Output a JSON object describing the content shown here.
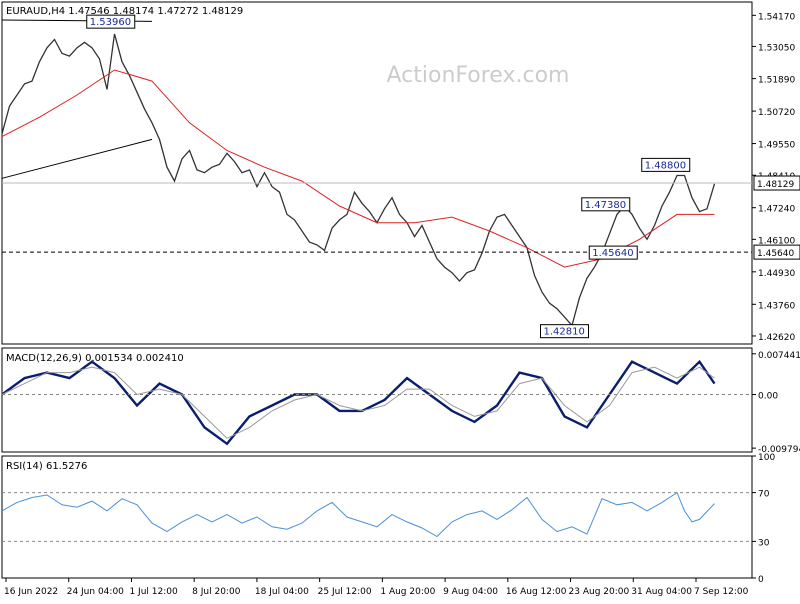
{
  "chart_data": {
    "type": "line",
    "symbol_header": "EURAUD,H4  1.47546 1.48174 1.47272 1.48129",
    "watermark": "ActionForex.com",
    "price_panel": {
      "ylim": [
        1.4233,
        1.5465
      ],
      "y_ticks": [
        "1.54170",
        "1.53050",
        "1.51890",
        "1.50720",
        "1.49550",
        "1.48410",
        "1.47240",
        "1.46100",
        "1.44930",
        "1.43760",
        "1.42620"
      ],
      "current_price": 1.48129,
      "current_price_label": "1.48129",
      "dashed_level": 1.4564,
      "dashed_level_label": "1.45640",
      "annotations": [
        {
          "label": "1.53960",
          "x": 0.145,
          "y": 1.5396
        },
        {
          "label": "1.48800",
          "x": 0.885,
          "y": 1.488
        },
        {
          "label": "1.47380",
          "x": 0.805,
          "y": 1.4738
        },
        {
          "label": "1.45640",
          "x": 0.815,
          "y": 1.4564
        },
        {
          "label": "1.42810",
          "x": 0.75,
          "y": 1.4281
        }
      ],
      "series": [
        {
          "name": "",
          "color": "#333333",
          "kind": "price",
          "x": [
            0,
            0.01,
            0.02,
            0.03,
            0.04,
            0.05,
            0.06,
            0.07,
            0.08,
            0.09,
            0.1,
            0.11,
            0.12,
            0.13,
            0.14,
            0.15,
            0.16,
            0.17,
            0.18,
            0.19,
            0.2,
            0.21,
            0.22,
            0.23,
            0.24,
            0.25,
            0.26,
            0.27,
            0.28,
            0.29,
            0.3,
            0.31,
            0.32,
            0.33,
            0.34,
            0.35,
            0.36,
            0.37,
            0.38,
            0.39,
            0.4,
            0.41,
            0.42,
            0.43,
            0.44,
            0.45,
            0.46,
            0.47,
            0.48,
            0.49,
            0.5,
            0.51,
            0.52,
            0.53,
            0.54,
            0.55,
            0.56,
            0.57,
            0.58,
            0.59,
            0.6,
            0.61,
            0.62,
            0.63,
            0.64,
            0.65,
            0.66,
            0.67,
            0.68,
            0.69,
            0.7,
            0.71,
            0.72,
            0.73,
            0.74,
            0.75,
            0.76,
            0.77,
            0.78,
            0.79,
            0.8,
            0.81,
            0.82,
            0.83,
            0.84,
            0.85,
            0.86,
            0.87,
            0.88,
            0.89,
            0.9,
            0.91,
            0.92,
            0.93,
            0.94,
            0.95
          ],
          "y": [
            1.499,
            1.509,
            1.513,
            1.517,
            1.518,
            1.525,
            1.53,
            1.533,
            1.528,
            1.527,
            1.53,
            1.532,
            1.53,
            1.526,
            1.515,
            1.535,
            1.525,
            1.52,
            1.514,
            1.508,
            1.503,
            1.497,
            1.487,
            1.482,
            1.49,
            1.493,
            1.486,
            1.485,
            1.487,
            1.488,
            1.492,
            1.489,
            1.485,
            1.486,
            1.48,
            1.485,
            1.48,
            1.478,
            1.47,
            1.468,
            1.464,
            1.46,
            1.459,
            1.457,
            1.465,
            1.468,
            1.47,
            1.478,
            1.474,
            1.471,
            1.467,
            1.472,
            1.476,
            1.47,
            1.467,
            1.462,
            1.466,
            1.46,
            1.454,
            1.451,
            1.449,
            1.446,
            1.449,
            1.45,
            1.456,
            1.464,
            1.469,
            1.47,
            1.466,
            1.462,
            1.458,
            1.448,
            1.442,
            1.438,
            1.436,
            1.433,
            1.43,
            1.44,
            1.447,
            1.451,
            1.456,
            1.463,
            1.47,
            1.473,
            1.47,
            1.465,
            1.461,
            1.466,
            1.473,
            1.478,
            1.484,
            1.484,
            1.476,
            1.471,
            1.472,
            1.481
          ]
        },
        {
          "name": "",
          "color": "#dd2222",
          "kind": "ma",
          "x": [
            0,
            0.05,
            0.1,
            0.15,
            0.2,
            0.25,
            0.3,
            0.35,
            0.4,
            0.45,
            0.5,
            0.55,
            0.6,
            0.65,
            0.7,
            0.75,
            0.8,
            0.85,
            0.9,
            0.95
          ],
          "y": [
            1.498,
            1.505,
            1.513,
            1.522,
            1.518,
            1.503,
            1.493,
            1.487,
            1.482,
            1.473,
            1.467,
            1.467,
            1.469,
            1.464,
            1.458,
            1.451,
            1.454,
            1.461,
            1.47,
            1.47
          ]
        },
        {
          "name": "",
          "color": "#000000",
          "kind": "trendline",
          "x": [
            0,
            0.2
          ],
          "y": [
            1.54,
            1.5395
          ]
        },
        {
          "name": "",
          "color": "#000000",
          "kind": "trendline",
          "x": [
            0,
            0.2
          ],
          "y": [
            1.483,
            1.497
          ]
        }
      ]
    },
    "macd_panel": {
      "label": "MACD(12,26,9) 0.001534 0.002410",
      "ylim": [
        -0.0105,
        0.0085
      ],
      "y_ticks": [
        "0.007441",
        "0.00",
        "-0.009794"
      ],
      "series": [
        {
          "name": "",
          "color": "#0a1e6e",
          "kind": "macd",
          "x": [
            0,
            0.03,
            0.06,
            0.09,
            0.12,
            0.15,
            0.18,
            0.21,
            0.24,
            0.27,
            0.3,
            0.33,
            0.36,
            0.39,
            0.42,
            0.45,
            0.48,
            0.51,
            0.54,
            0.57,
            0.6,
            0.63,
            0.66,
            0.69,
            0.72,
            0.75,
            0.78,
            0.81,
            0.84,
            0.87,
            0.9,
            0.93,
            0.95
          ],
          "y": [
            0.0,
            0.003,
            0.004,
            0.003,
            0.006,
            0.003,
            -0.002,
            0.002,
            0.0,
            -0.006,
            -0.009,
            -0.004,
            -0.002,
            0.0,
            0.0,
            -0.003,
            -0.003,
            -0.001,
            0.003,
            0.0,
            -0.003,
            -0.005,
            -0.002,
            0.004,
            0.003,
            -0.004,
            -0.006,
            0.0,
            0.006,
            0.004,
            0.002,
            0.006,
            0.002
          ]
        },
        {
          "name": "",
          "color": "#999999",
          "kind": "signal",
          "x": [
            0,
            0.03,
            0.06,
            0.09,
            0.12,
            0.15,
            0.18,
            0.21,
            0.24,
            0.27,
            0.3,
            0.33,
            0.36,
            0.39,
            0.42,
            0.45,
            0.48,
            0.51,
            0.54,
            0.57,
            0.6,
            0.63,
            0.66,
            0.69,
            0.72,
            0.75,
            0.78,
            0.81,
            0.84,
            0.87,
            0.9,
            0.93,
            0.95
          ],
          "y": [
            0.0,
            0.002,
            0.004,
            0.004,
            0.005,
            0.004,
            0.0,
            0.001,
            0.0,
            -0.004,
            -0.008,
            -0.006,
            -0.003,
            -0.001,
            0.0,
            -0.002,
            -0.003,
            -0.002,
            0.001,
            0.001,
            -0.002,
            -0.004,
            -0.003,
            0.002,
            0.003,
            -0.002,
            -0.005,
            -0.002,
            0.004,
            0.005,
            0.003,
            0.005,
            0.003
          ]
        }
      ]
    },
    "rsi_panel": {
      "label": "RSI(14) 61.5276",
      "ylim": [
        0,
        100
      ],
      "y_ticks": [
        "100",
        "70",
        "30",
        "0"
      ],
      "levels": [
        70,
        30
      ],
      "series": [
        {
          "name": "",
          "color": "#4a90d9",
          "kind": "rsi",
          "x": [
            0,
            0.02,
            0.04,
            0.06,
            0.08,
            0.1,
            0.12,
            0.14,
            0.16,
            0.18,
            0.2,
            0.22,
            0.24,
            0.26,
            0.28,
            0.3,
            0.32,
            0.34,
            0.36,
            0.38,
            0.4,
            0.42,
            0.44,
            0.46,
            0.48,
            0.5,
            0.52,
            0.54,
            0.56,
            0.58,
            0.6,
            0.62,
            0.64,
            0.66,
            0.68,
            0.7,
            0.72,
            0.74,
            0.76,
            0.78,
            0.8,
            0.82,
            0.84,
            0.86,
            0.88,
            0.9,
            0.91,
            0.92,
            0.93,
            0.95
          ],
          "y": [
            55,
            62,
            66,
            68,
            60,
            58,
            63,
            55,
            65,
            60,
            45,
            38,
            46,
            52,
            46,
            52,
            45,
            50,
            42,
            40,
            45,
            55,
            62,
            50,
            46,
            42,
            52,
            46,
            41,
            34,
            46,
            52,
            55,
            48,
            56,
            66,
            48,
            38,
            42,
            36,
            65,
            60,
            62,
            55,
            62,
            70,
            55,
            46,
            48,
            61
          ]
        }
      ]
    },
    "x_ticks": [
      "16 Jun 2022",
      "24 Jun 04:00",
      "1 Jul 12:00",
      "8 Jul 20:00",
      "18 Jul 04:00",
      "25 Jul 12:00",
      "1 Aug 20:00",
      "9 Aug 04:00",
      "16 Aug 12:00",
      "23 Aug 20:00",
      "31 Aug 04:00",
      "7 Sep 12:00"
    ],
    "grid": false
  }
}
